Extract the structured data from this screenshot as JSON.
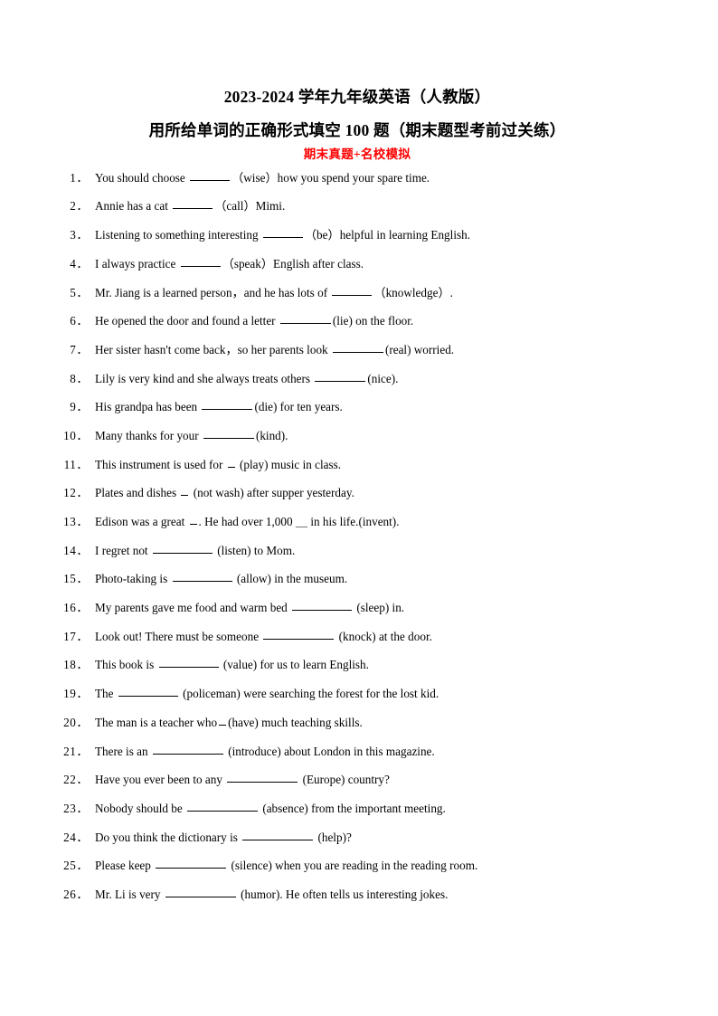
{
  "document": {
    "title": "2023-2024 学年九年级英语（人教版）",
    "subtitle": "用所给单词的正确形式填空 100 题（期末题型考前过关练）",
    "tagline": "期末真题+名校模拟",
    "tagline_color": "#FF0000"
  },
  "questions": [
    {
      "num": "1．",
      "before": "You should choose ",
      "blank": "sm",
      "after": "（wise）how you spend your spare time."
    },
    {
      "num": "2．",
      "before": "Annie has a cat ",
      "blank": "sm",
      "after": "（call）Mimi."
    },
    {
      "num": "3．",
      "before": "Listening to something interesting ",
      "blank": "sm",
      "after": "（be）helpful in learning English."
    },
    {
      "num": "4．",
      "before": "I always practice ",
      "blank": "sm",
      "after": "（speak）English after class."
    },
    {
      "num": "5．",
      "before": "Mr. Jiang is a learned person，and he has lots of ",
      "blank": "sm",
      "after": "（knowledge）."
    },
    {
      "num": "6．",
      "before": "He opened the door and found a letter ",
      "blank": "md",
      "after": "(lie) on the floor."
    },
    {
      "num": "7．",
      "before": "Her sister hasn't come back，so her parents look ",
      "blank": "md",
      "after": "(real) worried."
    },
    {
      "num": "8．",
      "before": "Lily is very kind and she always treats others ",
      "blank": "md",
      "after": "(nice)."
    },
    {
      "num": "9．",
      "before": "His grandpa has been ",
      "blank": "md",
      "after": "(die) for ten years."
    },
    {
      "num": "10．",
      "before": "Many thanks for your ",
      "blank": "md",
      "after": "(kind)."
    },
    {
      "num": "11．",
      "before": "This instrument is used for ",
      "blank": "xs",
      "after": " (play) music in class."
    },
    {
      "num": "12．",
      "before": "Plates and dishes ",
      "blank": "xs",
      "after": " (not wash) after supper yesterday."
    },
    {
      "num": "13．",
      "before": "Edison was a great ",
      "blank": "xs",
      "after": ". He had over 1,000 ＿ in his life.(invent)."
    },
    {
      "num": "14．",
      "before": "I regret not ",
      "blank": "lg",
      "after": " (listen) to Mom."
    },
    {
      "num": "15．",
      "before": "Photo-taking is ",
      "blank": "lg",
      "after": " (allow) in the museum."
    },
    {
      "num": "16．",
      "before": "My parents gave me food and warm bed ",
      "blank": "lg",
      "after": " (sleep) in."
    },
    {
      "num": "17．",
      "before": "Look out! There must be someone ",
      "blank": "xl",
      "after": " (knock) at the door."
    },
    {
      "num": "18．",
      "before": "This book is ",
      "blank": "lg",
      "after": " (value) for us to learn English."
    },
    {
      "num": "19．",
      "before": "The ",
      "blank": "lg",
      "after": " (policeman) were searching the forest for the lost kid."
    },
    {
      "num": "20．",
      "before": "The man is a teacher who",
      "blank": "xs",
      "after": "(have) much teaching skills."
    },
    {
      "num": "21．",
      "before": "There is an ",
      "blank": "xl",
      "after": " (introduce) about London in this magazine."
    },
    {
      "num": "22．",
      "before": "Have you ever been to any ",
      "blank": "xl",
      "after": " (Europe) country?"
    },
    {
      "num": "23．",
      "before": "Nobody should be ",
      "blank": "xl",
      "after": " (absence) from the important meeting."
    },
    {
      "num": "24．",
      "before": "Do you think the dictionary is ",
      "blank": "xl",
      "after": " (help)?"
    },
    {
      "num": "25．",
      "before": "Please keep ",
      "blank": "xl",
      "after": " (silence) when you are reading in the reading room."
    },
    {
      "num": "26．",
      "before": "Mr. Li is very ",
      "blank": "xl",
      "after": " (humor). He often tells us interesting jokes."
    }
  ]
}
